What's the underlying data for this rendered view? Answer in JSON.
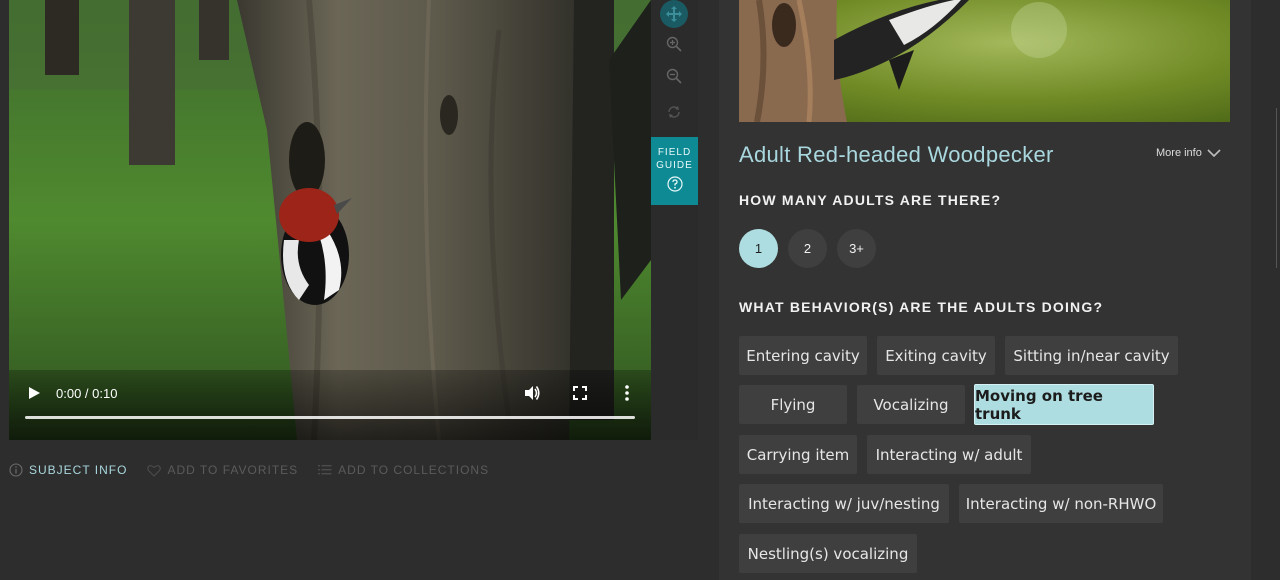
{
  "video": {
    "time": "0:00 / 0:10",
    "progress": 0.0
  },
  "toolbar": {
    "field_guide_line1": "FIELD",
    "field_guide_line2": "GUIDE"
  },
  "meta_bar": {
    "subject_info": "SUBJECT INFO",
    "add_to_favorites": "ADD TO FAVORITES",
    "add_to_collections": "ADD TO COLLECTIONS"
  },
  "panel": {
    "species": "Adult Red-headed Woodpecker",
    "more_info": "More info",
    "question_count": "HOW MANY ADULTS ARE THERE?",
    "count_options": [
      "1",
      "2",
      "3+"
    ],
    "count_selected": "1",
    "question_behavior": "WHAT BEHAVIOR(S) ARE THE ADULTS DOING?",
    "behaviors": [
      "Entering cavity",
      "Exiting cavity",
      "Sitting in/near cavity",
      "Flying",
      "Vocalizing",
      "Moving on tree trunk",
      "Carrying item",
      "Interacting w/ adult",
      "Interacting w/ juv/nesting",
      "Interacting w/ non-RHWO",
      "Nestling(s) vocalizing"
    ],
    "behavior_selected": "Moving on tree trunk"
  },
  "colors": {
    "accent": "#a9d7de",
    "selected_bg": "#addde0",
    "field_guide_bg": "#0d8a93",
    "panel_bg": "#333333",
    "page_bg": "#2d2d2d"
  }
}
